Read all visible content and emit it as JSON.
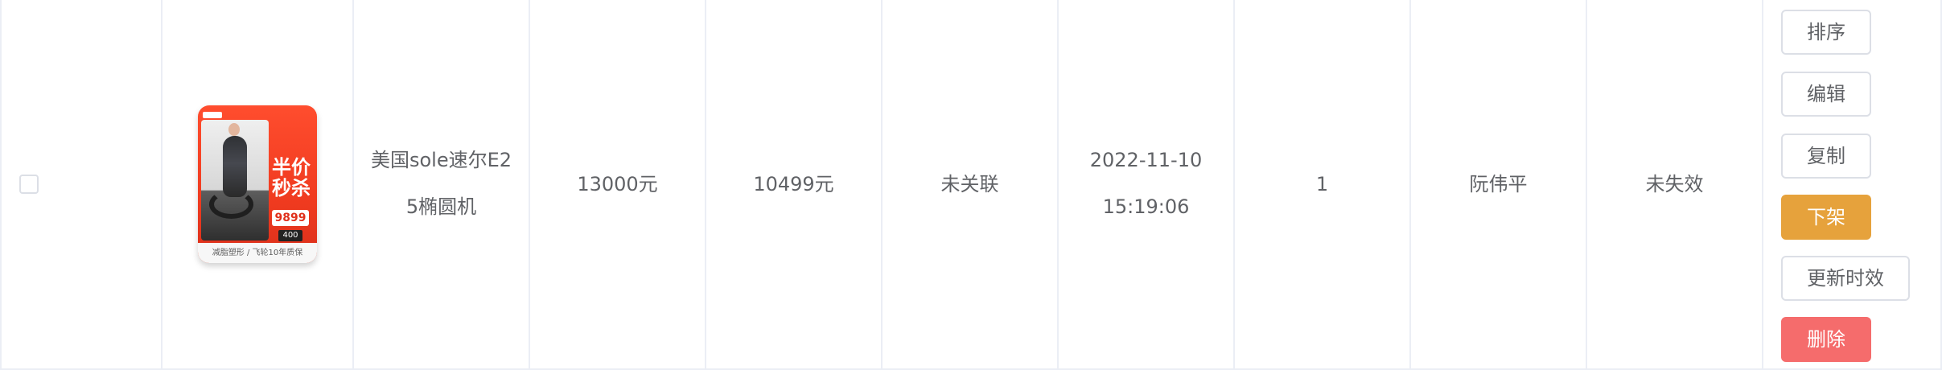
{
  "row": {
    "product_image": {
      "image_text_big": "半价\n秒杀",
      "image_price": "9899",
      "image_badge": "400",
      "image_tag": "天猫",
      "image_bottom": "减脂塑形 / 飞轮10年质保"
    },
    "name": "美国sole速尔E25椭圆机",
    "original_price": "13000元",
    "sale_price": "10499元",
    "link_status": "未关联",
    "time": "2022-11-10 15:19:06",
    "sort": "1",
    "owner": "阮伟平",
    "validity": "未失效"
  },
  "actions": {
    "sort": "排序",
    "edit": "编辑",
    "copy": "复制",
    "off_shelf": "下架",
    "refresh_validity": "更新时效",
    "delete": "删除"
  },
  "colors": {
    "border": "#ebeef5",
    "text": "#606266",
    "warning": "#e6a23c",
    "danger": "#f56c6c",
    "product_red": "#ef3a1f"
  }
}
